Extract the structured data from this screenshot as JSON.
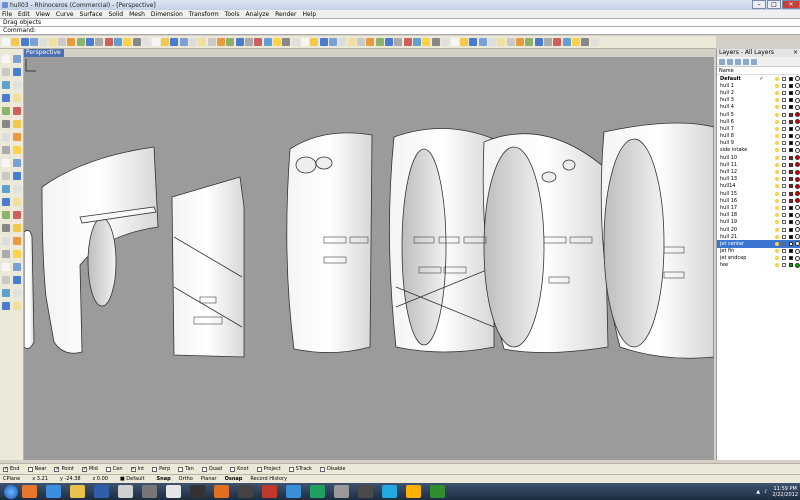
{
  "window": {
    "title": "hull03 - Rhinoceros (Commercial) - [Perspective]",
    "controls": [
      "–",
      "□",
      "✕"
    ]
  },
  "menu": [
    "File",
    "Edit",
    "View",
    "Curve",
    "Surface",
    "Solid",
    "Mesh",
    "Dimension",
    "Transform",
    "Tools",
    "Analyze",
    "Render",
    "Help"
  ],
  "command": {
    "history": "Drag objects",
    "prompt": "Command:",
    "value": ""
  },
  "viewport": {
    "tab": "Perspective",
    "background": "#9b9b9b"
  },
  "layers_panel": {
    "title": "Layers - All Layers",
    "column_name": "Name",
    "rows": [
      {
        "name": "Default",
        "current": "✓",
        "color": "#000000",
        "bold": true
      },
      {
        "name": "hull 1",
        "color": "#000000"
      },
      {
        "name": "hull 2",
        "color": "#000000"
      },
      {
        "name": "hull 3",
        "color": "#000000"
      },
      {
        "name": "hull 4",
        "color": "#000000"
      },
      {
        "name": "hull 5",
        "color": "#cc0000"
      },
      {
        "name": "hull 6",
        "color": "#cc0000"
      },
      {
        "name": "hull 7",
        "color": "#000000"
      },
      {
        "name": "hull 8",
        "color": "#000000"
      },
      {
        "name": "hull 9",
        "color": "#000000"
      },
      {
        "name": "side intake",
        "color": "#000000"
      },
      {
        "name": "hull 10",
        "color": "#cc0000"
      },
      {
        "name": "hull 11",
        "color": "#cc0000"
      },
      {
        "name": "hull 12",
        "color": "#cc0000"
      },
      {
        "name": "hull 13",
        "color": "#cc0000"
      },
      {
        "name": "hull14",
        "color": "#cc0000"
      },
      {
        "name": "hull 15",
        "color": "#cc0000"
      },
      {
        "name": "hull 16",
        "color": "#cc0000"
      },
      {
        "name": "hull 17",
        "color": "#000000"
      },
      {
        "name": "hull 18",
        "color": "#000000"
      },
      {
        "name": "hull 19",
        "color": "#000000"
      },
      {
        "name": "hull 20",
        "color": "#000000"
      },
      {
        "name": "hull 21",
        "color": "#000000"
      },
      {
        "name": "jet center",
        "color": "#ffffff",
        "selected": true
      },
      {
        "name": "jet fin",
        "color": "#000000"
      },
      {
        "name": "jet endcap",
        "color": "#000000"
      },
      {
        "name": "tee",
        "color": "#00aa00"
      }
    ]
  },
  "osnaps": [
    {
      "label": "End",
      "checked": true
    },
    {
      "label": "Near",
      "checked": false
    },
    {
      "label": "Point",
      "checked": true
    },
    {
      "label": "Mid",
      "checked": true
    },
    {
      "label": "Cen",
      "checked": false
    },
    {
      "label": "Int",
      "checked": true
    },
    {
      "label": "Perp",
      "checked": false
    },
    {
      "label": "Tan",
      "checked": false
    },
    {
      "label": "Quad",
      "checked": false
    },
    {
      "label": "Knot",
      "checked": false
    },
    {
      "label": "Project",
      "checked": false
    },
    {
      "label": "STrack",
      "checked": false
    },
    {
      "label": "Disable",
      "checked": false
    }
  ],
  "status": {
    "cplane": "CPlane",
    "x": "x 3.21",
    "y": "y -24.38",
    "z": "z 0.00",
    "layer": "Default",
    "toggles": [
      {
        "label": "Snap",
        "on": true
      },
      {
        "label": "Ortho",
        "on": false
      },
      {
        "label": "Planar",
        "on": false
      },
      {
        "label": "Osnap",
        "on": true
      },
      {
        "label": "Record History",
        "on": false
      }
    ]
  },
  "taskbar": {
    "apps": [
      "firefox",
      "chrome",
      "explorer",
      "ps",
      "media",
      "rhino",
      "ball",
      "zbrush",
      "blender",
      "steam",
      "ppt",
      "app",
      "app2",
      "gimp",
      "app3",
      "skype",
      "ai",
      "app4"
    ],
    "time": "11:59 PM",
    "date": "2/22/2012"
  }
}
